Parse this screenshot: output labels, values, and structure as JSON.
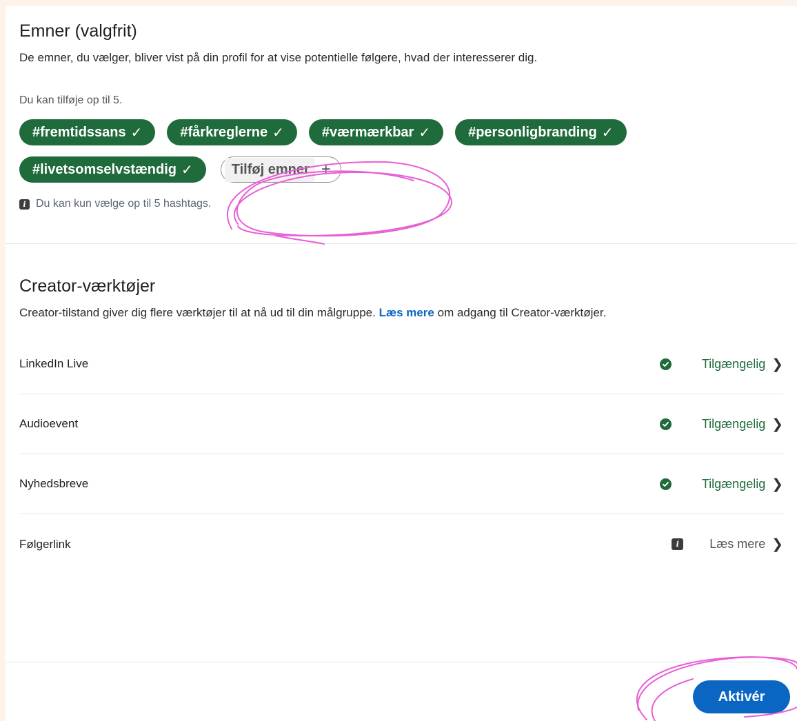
{
  "topics": {
    "title": "Emner (valgfrit)",
    "description": "De emner, du vælger, bliver vist på din profil for at vise potentielle følgere, hvad der interesserer dig.",
    "hint": "Du kan tilføje op til 5.",
    "hashtags": [
      {
        "label": "#fremtidssans",
        "check": "✓"
      },
      {
        "label": "#fårkreglerne",
        "check": "✓"
      },
      {
        "label": "#værmærkbar",
        "check": "✓"
      },
      {
        "label": "#personligbranding",
        "check": "✓"
      },
      {
        "label": "#livetsomselvstændig",
        "check": "✓"
      }
    ],
    "add_label": "Tilføj emner",
    "add_icon": "+",
    "limit_note": "Du kan kun vælge op til 5 hashtags."
  },
  "creator": {
    "title": "Creator-værktøjer",
    "description_before": "Creator-tilstand giver dig flere værktøjer til at nå ud til din målgruppe. ",
    "link_text": "Læs mere",
    "description_after": " om adgang til Creator-værktøjer.",
    "tools": [
      {
        "name": "LinkedIn Live",
        "status": "Tilgængelig",
        "icon": "check-circle-icon"
      },
      {
        "name": "Audioevent",
        "status": "Tilgængelig",
        "icon": "check-circle-icon"
      },
      {
        "name": "Nyhedsbreve",
        "status": "Tilgængelig",
        "icon": "check-circle-icon"
      },
      {
        "name": "Følgerlink",
        "status": "Læs mere",
        "icon": "info-icon"
      }
    ],
    "chevron": "❯"
  },
  "footer": {
    "activate_label": "Aktivér"
  },
  "colors": {
    "chip_green": "#1f6b3b",
    "primary_blue": "#0a66c2",
    "annotation_pink": "#e75fd6"
  }
}
